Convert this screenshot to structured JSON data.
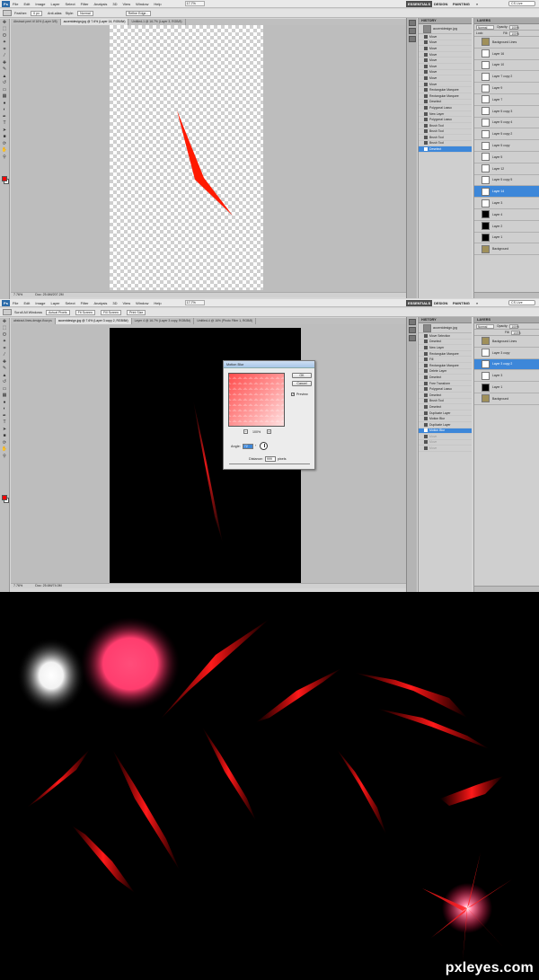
{
  "screen1": {
    "menu": [
      "File",
      "Edit",
      "Image",
      "Layer",
      "Select",
      "Filter",
      "Analysis",
      "3D",
      "View",
      "Window",
      "Help"
    ],
    "logo": "Ps",
    "zoom": "17.7%",
    "workspaces": [
      "ESSENTIALS",
      "DESIGN",
      "PAINTING"
    ],
    "more": "»",
    "search_placeholder": "CS Live",
    "options": {
      "feather_label": "Feather:",
      "feather_value": "0 px",
      "antialias": "Anti-alias",
      "style_label": "Style:",
      "style_value": "Normal",
      "refine": "Refine Edge..."
    },
    "doc_tabs": [
      "Abstract peel 4f 16% (Layer 3/8)",
      "accentdesign.jpg @ 7.6% (Layer 14, RGB/8#)",
      "Untitled-1 @ 16.7% (Layer 3, RGB/8)"
    ],
    "status": {
      "zoom": "7.76%",
      "doc": "Doc: 25.6M/207.2M"
    },
    "history": {
      "tab": "HISTORY",
      "snapshot": "accentdesign.jpg",
      "items": [
        "Move",
        "Move",
        "Move",
        "Move",
        "Move",
        "Move",
        "Move",
        "Move",
        "Move",
        "Rectangular Marquee",
        "Rectangular Marquee",
        "Deselect",
        "Polygonal Lasso",
        "New Layer",
        "Polygonal Lasso",
        "Brush Tool",
        "Brush Tool",
        "Brush Tool",
        "Brush Tool",
        "Deselect"
      ],
      "selected_index": 19
    },
    "layers": {
      "tabs": "LAYERS",
      "blend": "Normal",
      "opacity_label": "Opacity:",
      "opacity": "100%",
      "lock_label": "Lock:",
      "fill_label": "Fill:",
      "fill": "100%",
      "items": [
        "Background Lines",
        "Layer 16",
        "Layer 10",
        "Layer 7 copy 2",
        "Layer 9",
        "Layer 7",
        "Layer 5 copy 3",
        "Layer 5 copy 4",
        "Layer 5 copy 2",
        "Layer 5 copy",
        "Layer 5",
        "Layer 12",
        "Layer 5 copy 5",
        "Layer 14",
        "Layer 3",
        "Layer 4",
        "Layer 2",
        "Layer 1",
        "Background"
      ],
      "selected_index": 13
    }
  },
  "screen2": {
    "menu": [
      "File",
      "Edit",
      "Image",
      "Layer",
      "Select",
      "Filter",
      "Analysis",
      "3D",
      "View",
      "Window",
      "Help"
    ],
    "logo": "Ps",
    "zoom": "17.7%",
    "workspaces": [
      "ESSENTIALS",
      "DESIGN",
      "PAINTING"
    ],
    "more": "»",
    "search_placeholder": "CS Live",
    "options": {
      "tool": "Scroll All Windows",
      "fit": "Actual Pixels",
      "fill": "Fit Screen",
      "fill2": "Fill Screen",
      "print": "Print Size"
    },
    "doc_tabs": [
      "abstract-lines-design-flow.ps",
      "accentdesign.jpg @ 7.6% (Layer 3 copy 2, RGB/8#)",
      "Layer 4 @ 16.7% (Layer 3 copy, RGB/8#)",
      "Untitled-4 @ 16% (Photo Filter 1, RGB/8)"
    ],
    "status": {
      "zoom": "7.76%",
      "doc": "Doc: 25.6M/74.0M"
    },
    "history": {
      "tab": "HISTORY",
      "snapshot": "accentdesign.jpg",
      "items": [
        "Move Selection",
        "Deselect",
        "New Layer",
        "Rectangular Marquee",
        "Fill",
        "Rectangular Marquee",
        "Delete Layer",
        "Deselect",
        "Free Transform",
        "Polygonal Lasso",
        "Deselect",
        "Brush Tool",
        "Deselect",
        "Duplicate Layer",
        "Motion Blur",
        "Duplicate Layer",
        "Motion Blur",
        "Move",
        "Move",
        "Move"
      ],
      "selected_index": 16,
      "dim_from": 17
    },
    "layers": {
      "tabs": "LAYERS",
      "blend": "Normal",
      "opacity_label": "Opacity:",
      "opacity": "100%",
      "fill_label": "Fill:",
      "fill": "100%",
      "items": [
        "Background Lines",
        "Layer 3 copy",
        "Layer 3 copy 2",
        "Layer 3",
        "Layer 1",
        "Background"
      ],
      "selected_index": 2
    },
    "dialog": {
      "title": "Motion Blur",
      "ok": "OK",
      "cancel": "Cancel",
      "preview_label": "Preview",
      "preview_checked": "✓",
      "zoom_level": "100%",
      "zoom_minus": "−",
      "zoom_plus": "+",
      "angle_label": "Angle:",
      "angle_value": "72",
      "angle_unit": "°",
      "distance_label": "Distance:",
      "distance_value": "999",
      "distance_unit": "pixels"
    }
  },
  "result": {
    "watermark": "pxleyes.com"
  },
  "colors": {
    "accent_red": "#ff0000",
    "selection_blue": "#3d87d9",
    "pink_glow": "#ff4d7a"
  }
}
